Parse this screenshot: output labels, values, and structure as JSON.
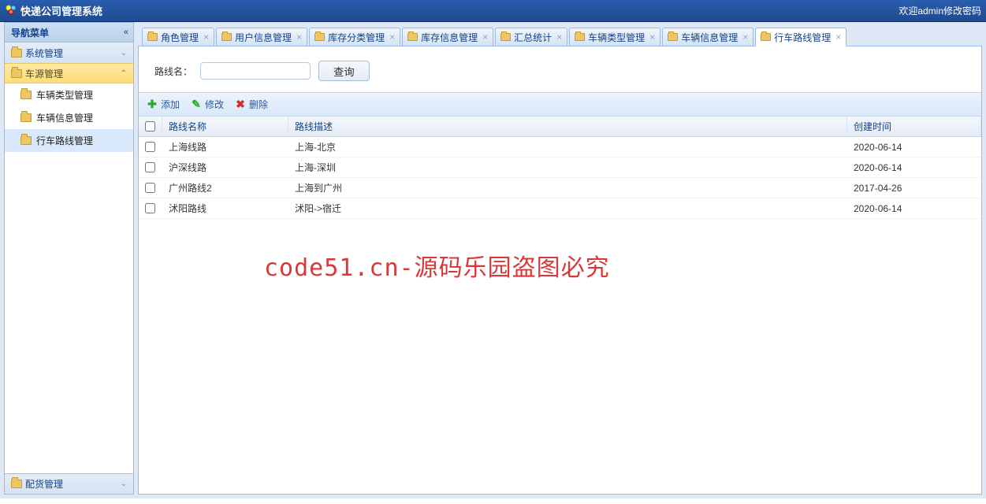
{
  "header": {
    "title": "快递公司管理系统",
    "welcome": "欢迎admin修改密码"
  },
  "sidebar": {
    "title": "导航菜单",
    "sections": [
      {
        "label": "系统管理",
        "expanded": false
      },
      {
        "label": "车源管理",
        "expanded": true
      },
      {
        "label": "配货管理",
        "expanded": false
      }
    ],
    "tree": [
      {
        "label": "车辆类型管理"
      },
      {
        "label": "车辆信息管理"
      },
      {
        "label": "行车路线管理"
      }
    ]
  },
  "tabs": [
    {
      "label": "角色管理"
    },
    {
      "label": "用户信息管理"
    },
    {
      "label": "库存分类管理"
    },
    {
      "label": "库存信息管理"
    },
    {
      "label": "汇总统计"
    },
    {
      "label": "车辆类型管理"
    },
    {
      "label": "车辆信息管理"
    },
    {
      "label": "行车路线管理"
    }
  ],
  "search": {
    "label": "路线名：",
    "value": "",
    "button": "查询"
  },
  "tools": {
    "add": "添加",
    "edit": "修改",
    "delete": "删除"
  },
  "grid": {
    "columns": {
      "name": "路线名称",
      "desc": "路线描述",
      "date": "创建时间"
    },
    "rows": [
      {
        "name": "上海线路",
        "desc": "上海-北京",
        "date": "2020-06-14"
      },
      {
        "name": "沪深线路",
        "desc": "上海-深圳",
        "date": "2020-06-14"
      },
      {
        "name": "广州路线2",
        "desc": "上海到广州",
        "date": "2017-04-26"
      },
      {
        "name": "沭阳路线",
        "desc": "沭阳->宿迁",
        "date": "2020-06-14"
      }
    ]
  },
  "watermark": "code51.cn-源码乐园盗图必究"
}
